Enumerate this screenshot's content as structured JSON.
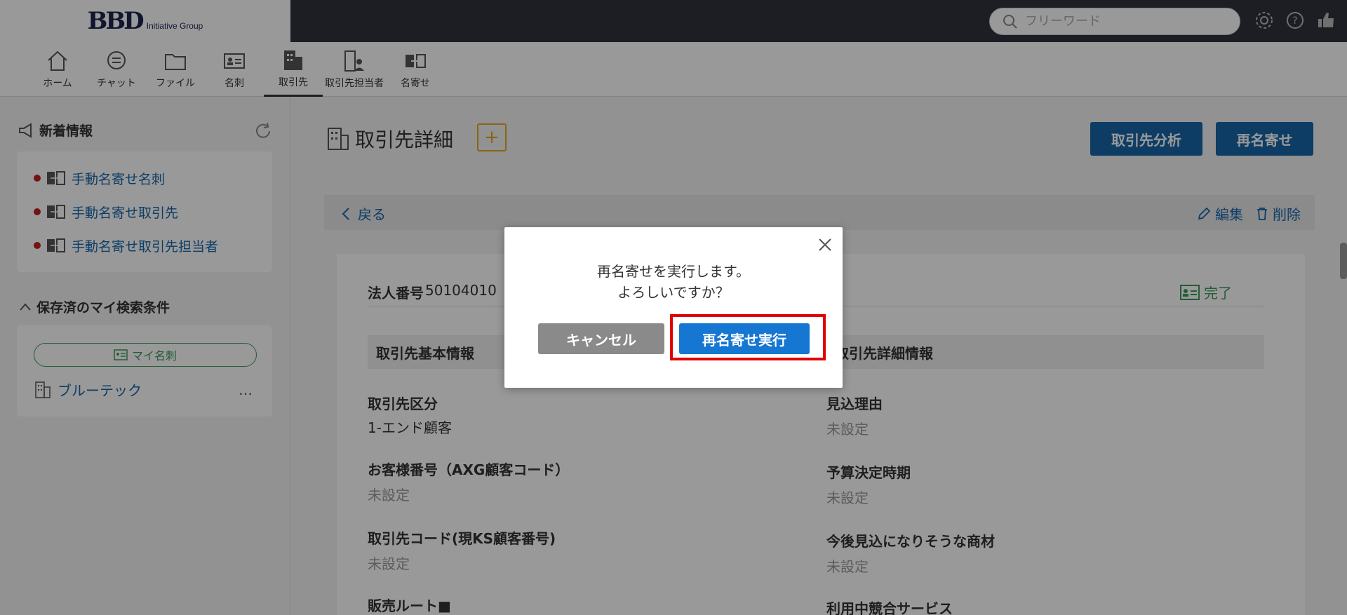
{
  "header": {
    "logo_text": "BBD",
    "logo_sub": "Initiative Group",
    "search_placeholder": "フリーワード"
  },
  "nav": {
    "items": [
      {
        "label": "ホーム"
      },
      {
        "label": "チャット"
      },
      {
        "label": "ファイル"
      },
      {
        "label": "名刺"
      },
      {
        "label": "取引先"
      },
      {
        "label": "取引先担当者"
      },
      {
        "label": "名寄せ"
      }
    ]
  },
  "sidebar": {
    "news_title": "新着情報",
    "news_items": [
      {
        "label": "手動名寄せ名刺"
      },
      {
        "label": "手動名寄せ取引先"
      },
      {
        "label": "手動名寄せ取引先担当者"
      }
    ],
    "saved_title": "保存済のマイ検索条件",
    "my_card_label": "マイ名刺",
    "saved_link": "ブルーテック",
    "more": "…"
  },
  "main": {
    "title": "取引先詳細",
    "plus_label": "+",
    "analysis_button": "取引先分析",
    "rematch_button": "再名寄せ",
    "back_label": "戻る",
    "edit_label": "編集",
    "delete_label": "削除",
    "corp_number_label": "法人番号",
    "corp_number_value": "50104010",
    "done_label": "完了",
    "basic_info_head": "取引先基本情報",
    "detail_info_head": "取引先詳細情報",
    "left_fields": [
      {
        "label": "取引先区分",
        "value": "1-エンド顧客"
      },
      {
        "label": "お客様番号（AXG顧客コード）",
        "value": "未設定"
      },
      {
        "label": "取引先コード(現KS顧客番号)",
        "value": "未設定"
      },
      {
        "label": "販売ルート■",
        "value": ""
      }
    ],
    "right_fields": [
      {
        "label": "見込理由",
        "value": "未設定"
      },
      {
        "label": "予算決定時期",
        "value": "未設定"
      },
      {
        "label": "今後見込になりそうな商材",
        "value": "未設定"
      },
      {
        "label": "利用中競合サービス",
        "value": ""
      }
    ]
  },
  "modal": {
    "message_line1": "再名寄せを実行します。",
    "message_line2": "よろしいですか？",
    "cancel_label": "キャンセル",
    "execute_label": "再名寄せ実行"
  },
  "colors": {
    "accent_blue": "#1766a8",
    "highlight_red": "#e00000",
    "green": "#3c9a5a",
    "orange": "#e0a825"
  }
}
